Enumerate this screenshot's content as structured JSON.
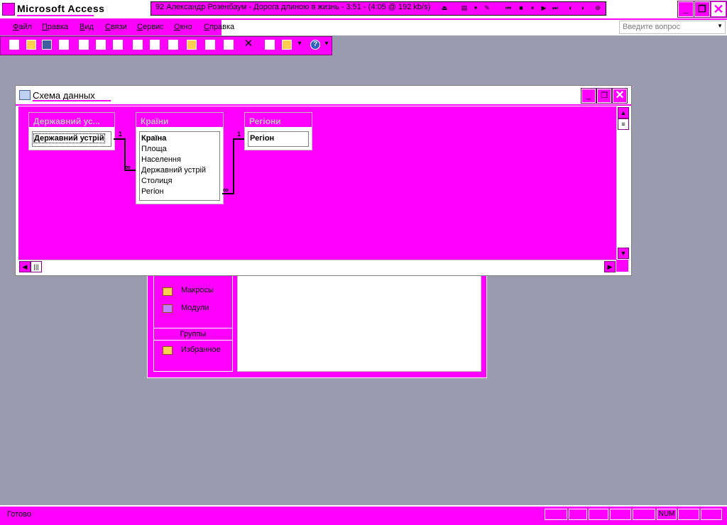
{
  "app": {
    "title": "Microsoft Access"
  },
  "winamp": {
    "now_playing": "92 Александр Розенбаум - Дорога длиною в жизнь - 3:51 - (4:05 @ 192 kb/s)"
  },
  "menu": {
    "items": [
      "Файл",
      "Правка",
      "Вид",
      "Связи",
      "Сервис",
      "Окно",
      "Справка"
    ],
    "ask_placeholder": "Введите вопрос"
  },
  "db_window": {
    "objects": [
      {
        "label": "Макросы",
        "icon": "macro-icon"
      },
      {
        "label": "Модули",
        "icon": "module-icon"
      }
    ],
    "group_header": "Группы",
    "groups": [
      {
        "label": "Избранное",
        "icon": "favorites-icon"
      }
    ]
  },
  "relationships_window": {
    "title": "Схема данных",
    "tables": [
      {
        "name": "Державний ус...",
        "fields": [
          "Державний устрій"
        ],
        "primary_field": "Державний устрій"
      },
      {
        "name": "Країни",
        "fields": [
          "Країна",
          "Площа",
          "Населення",
          "Державний устрій",
          "Столиця",
          "Регіон"
        ],
        "primary_field": "Країна"
      },
      {
        "name": "Регіони",
        "fields": [
          "Регіон"
        ],
        "primary_field": "Регіон"
      }
    ],
    "relations": [
      {
        "one_label": "1",
        "many_label": "∞"
      },
      {
        "one_label": "1",
        "many_label": "∞"
      }
    ]
  },
  "status": {
    "text": "Готово",
    "num_indicator": "NUM"
  },
  "colors": {
    "accent": "#ff00ff",
    "desktop": "#9b9bb0"
  }
}
